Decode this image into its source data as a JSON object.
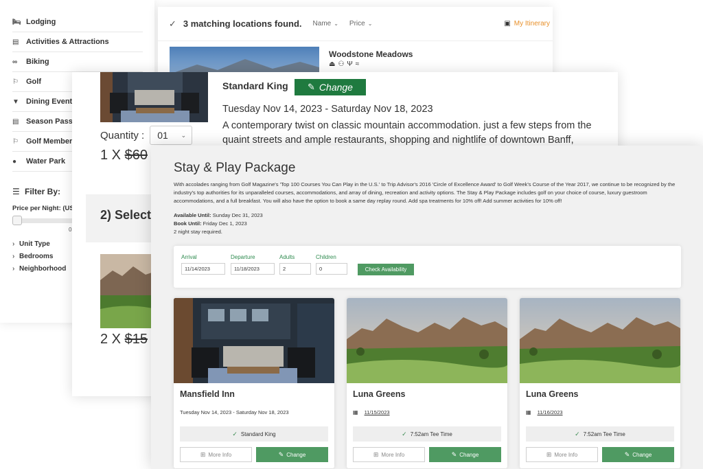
{
  "sidebar": {
    "categories": [
      {
        "label": "Lodging",
        "icon": "bed-icon"
      },
      {
        "label": "Activities & Attractions",
        "icon": "ticket-icon"
      },
      {
        "label": "Biking",
        "icon": "bicycle-icon"
      },
      {
        "label": "Golf",
        "icon": "flag-icon"
      },
      {
        "label": "Dining Events",
        "icon": "cocktail-icon"
      },
      {
        "label": "Season Passes",
        "icon": "card-icon"
      },
      {
        "label": "Golf Memberships",
        "icon": "flag-icon"
      },
      {
        "label": "Water Park",
        "icon": "drop-icon"
      }
    ],
    "filter_title": "Filter By:",
    "price_label": "Price per Night: (US",
    "price_min": "0",
    "facets": [
      "Unit Type",
      "Bedrooms",
      "Neighborhood"
    ]
  },
  "results": {
    "count_text": "3 matching locations found.",
    "sort_name": "Name",
    "sort_price": "Price",
    "itinerary": "My Itinerary",
    "first_result_name": "Woodstone Meadows",
    "amenity_icons": [
      "fireplace-icon",
      "group-icon",
      "dining-icon",
      "wifi-icon"
    ]
  },
  "room": {
    "title": "Standard King",
    "change_label": "Change",
    "dates": "Tuesday Nov 14, 2023 - Saturday Nov 18, 2023",
    "description": "A contemporary twist on classic mountain accommodation. just a few steps from the quaint streets and ample restaurants, shopping and nightlife of downtown Banff,",
    "quantity_label": "Quantity :",
    "quantity_value": "01",
    "price_prefix": "1 X ",
    "price_strike": "$60",
    "section_title": "2) Select",
    "price2_prefix": "2 X ",
    "price2_strike": "$15"
  },
  "package": {
    "title": "Stay & Play Package",
    "description": "With accolades ranging from Golf Magazine's 'Top 100 Courses You Can Play in the U.S.' to Trip Advisor's 2016 'Circle of Excellence Award' to Golf Week's Course of the Year 2017, we continue to be recognized by the industry's top authorities for its unparalleled courses, accommodations, and array of dining, recreation and activity options. The Stay & Play Package includes golf on your choice of course, luxury guestroom accommodations, and a full breakfast. You will also have the option to book a same day replay round. Add spa treatments for 10% off! Add summer activities for 10% off!",
    "available_until_label": "Available Until:",
    "available_until": "Sunday Dec 31, 2023",
    "book_until_label": "Book Until:",
    "book_until": "Friday Dec 1, 2023",
    "min_stay": "2 night stay required.",
    "form": {
      "arrival_label": "Arrival",
      "arrival_value": "11/14/2023",
      "departure_label": "Departure",
      "departure_value": "11/18/2023",
      "adults_label": "Adults",
      "adults_value": "2",
      "children_label": "Children",
      "children_value": "0",
      "check_label": "Check Availability"
    },
    "cards": [
      {
        "name": "Mansfield Inn",
        "sub": "Tuesday Nov 14, 2023 - Saturday Nov 18, 2023",
        "badge": "Standard King",
        "more": "More Info",
        "change": "Change"
      },
      {
        "name": "Luna Greens",
        "sub": "11/15/2023",
        "badge": "7:52am Tee Time",
        "more": "More Info",
        "change": "Change"
      },
      {
        "name": "Luna Greens",
        "sub": "11/16/2023",
        "badge": "7:52am Tee Time",
        "more": "More Info",
        "change": "Change"
      }
    ]
  },
  "colors": {
    "green_dark": "#1f7a3f",
    "green": "#4f9a62",
    "label_green": "#2d8a4e",
    "accent_orange": "#e8902a"
  }
}
